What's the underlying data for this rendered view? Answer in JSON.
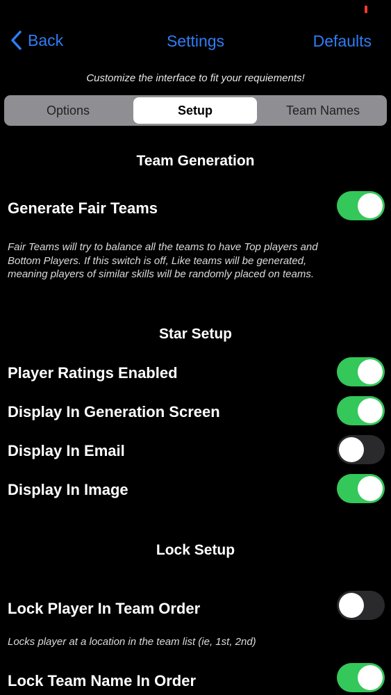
{
  "nav": {
    "back_label": "Back",
    "title": "Settings",
    "defaults_label": "Defaults",
    "accent_color": "#2f7df6"
  },
  "subtitle": "Customize the interface to fit your requiements!",
  "tabs": [
    {
      "label": "Options",
      "selected": false
    },
    {
      "label": "Setup",
      "selected": true
    },
    {
      "label": "Team Names",
      "selected": false
    }
  ],
  "sections": {
    "team_generation": {
      "title": "Team Generation",
      "generate_fair_teams": {
        "label": "Generate Fair Teams",
        "on": true
      },
      "description": "Fair Teams will try to balance all the teams to have Top players and Bottom Players.   If this switch is off, Like teams will be generated, meaning players of similar skills will be randomly placed on teams."
    },
    "star_setup": {
      "title": "Star Setup",
      "items": [
        {
          "label": "Player Ratings Enabled",
          "on": true
        },
        {
          "label": "Display In Generation Screen",
          "on": true
        },
        {
          "label": "Display In Email",
          "on": false
        },
        {
          "label": "Display In Image",
          "on": true
        }
      ]
    },
    "lock_setup": {
      "title": "Lock Setup",
      "lock_player": {
        "label": "Lock Player In Team Order",
        "on": false
      },
      "lock_player_description": "Locks player at a location in the team list (ie, 1st, 2nd)",
      "lock_team_name": {
        "label": "Lock Team Name In Order",
        "on": true
      }
    }
  },
  "colors": {
    "toggle_on": "#34c759",
    "toggle_off": "#2a2a2c",
    "background": "#000000"
  }
}
